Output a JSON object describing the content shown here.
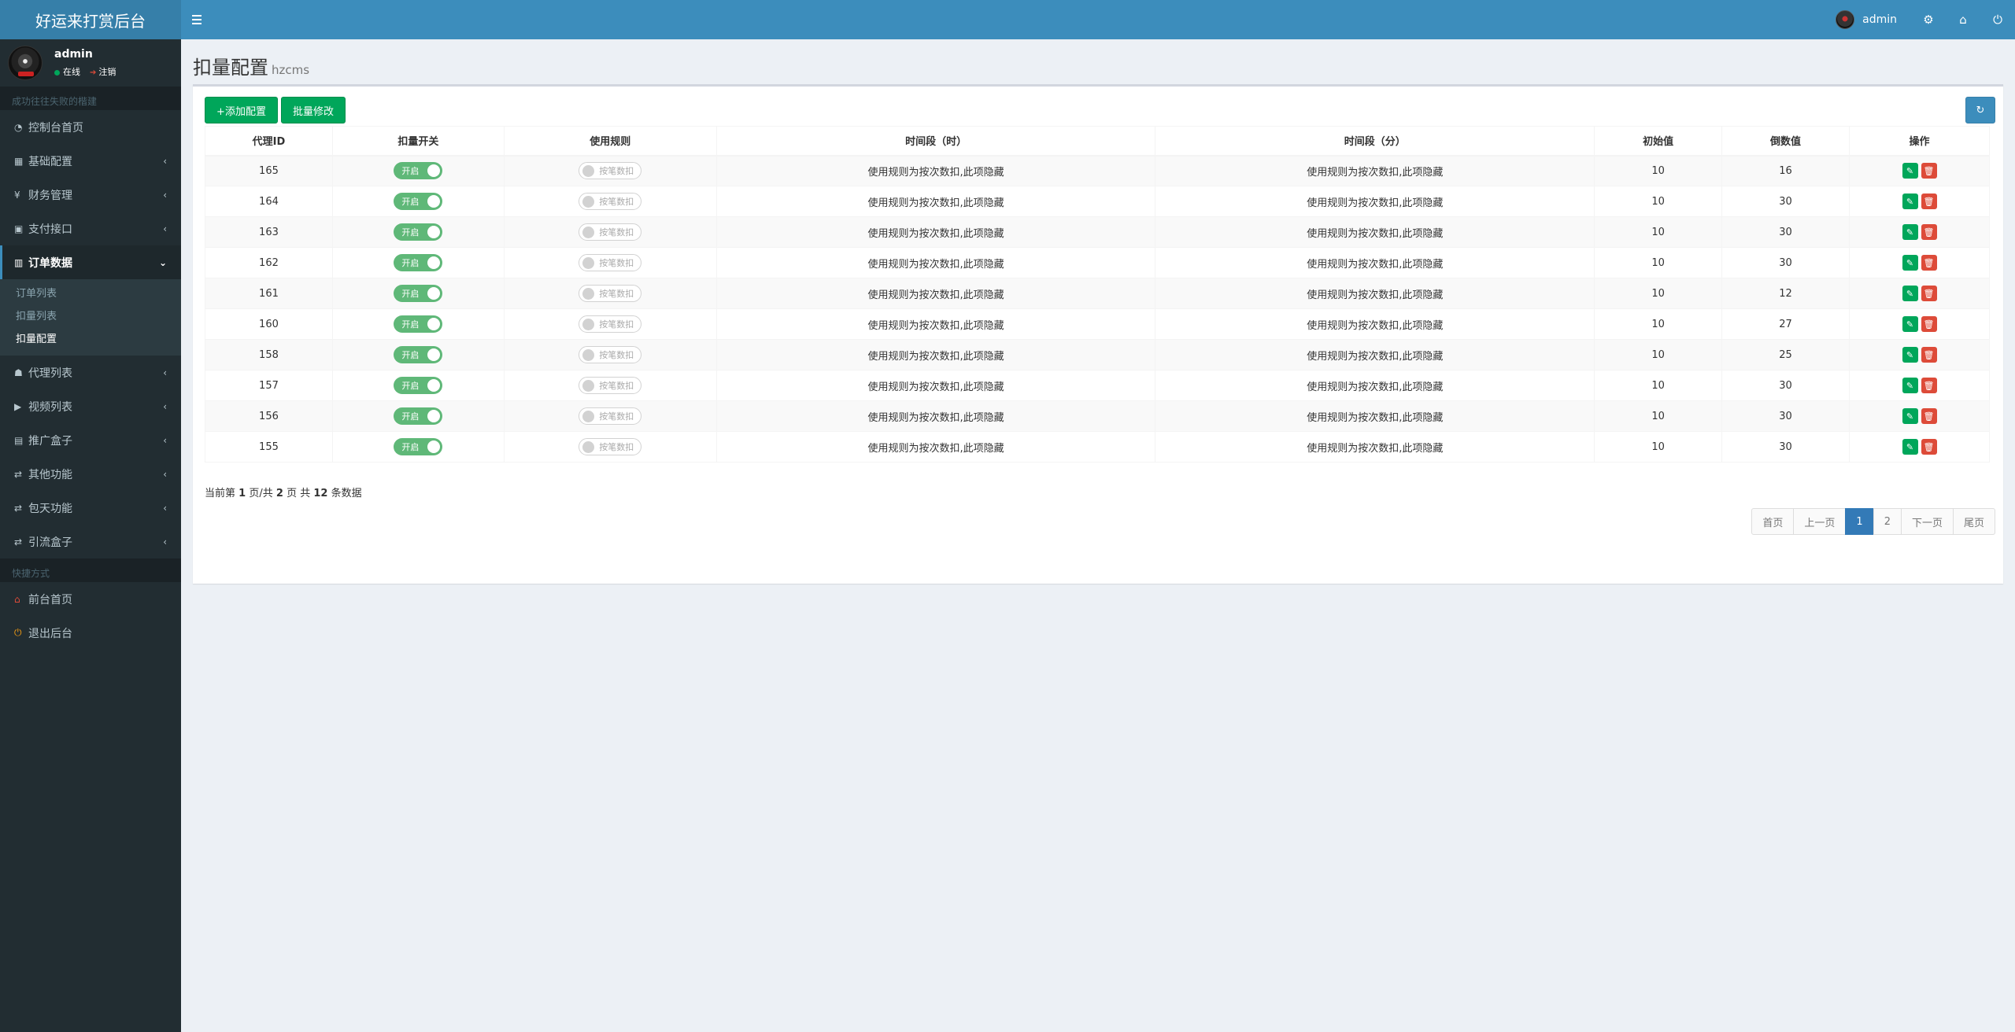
{
  "app": {
    "title": "好运来打赏后台"
  },
  "topbar": {
    "user_name": "admin",
    "icons": [
      "gears-icon",
      "home-icon",
      "power-icon"
    ]
  },
  "sidebar": {
    "user_name": "admin",
    "status_online": "在线",
    "status_logout": "注销",
    "header_text": "成功往往失败的楷建",
    "menu": [
      {
        "label": "控制台首页",
        "icon": "dashboard-icon",
        "has_children": false
      },
      {
        "label": "基础配置",
        "icon": "grid-icon",
        "has_children": true
      },
      {
        "label": "财务管理",
        "icon": "yen-icon",
        "has_children": true
      },
      {
        "label": "支付接口",
        "icon": "payment-icon",
        "has_children": true
      },
      {
        "label": "订单数据",
        "icon": "bar-chart-icon",
        "has_children": true,
        "expanded": true
      }
    ],
    "submenu": [
      "订单列表",
      "扣量列表",
      "扣量配置"
    ],
    "menu2": [
      {
        "label": "代理列表",
        "icon": "users-icon"
      },
      {
        "label": "视频列表",
        "icon": "video-icon"
      },
      {
        "label": "推广盒子",
        "icon": "box-icon"
      },
      {
        "label": "其他功能",
        "icon": "retweet-icon"
      },
      {
        "label": "包天功能",
        "icon": "retweet-icon"
      },
      {
        "label": "引流盒子",
        "icon": "retweet-icon"
      }
    ],
    "shortcut_header": "快捷方式",
    "shortcuts": [
      {
        "label": "前台首页",
        "icon": "home-icon",
        "color": "#dd4b39"
      },
      {
        "label": "退出后台",
        "icon": "power-icon",
        "color": "#f39c12"
      }
    ]
  },
  "page": {
    "title": "扣量配置",
    "subtitle": "hzcms"
  },
  "toolbar": {
    "add_label": "+添加配置",
    "batch_label": "批量修改"
  },
  "table": {
    "headers": [
      "代理ID",
      "扣量开关",
      "使用规则",
      "时间段（时）",
      "时间段（分）",
      "初始值",
      "倒数值",
      "操作"
    ],
    "switch_on_label": "开启",
    "rule_label": "按笔数扣",
    "rows": [
      {
        "id": "165",
        "hour": "使用规则为按次数扣,此项隐藏",
        "minute": "使用规则为按次数扣,此项隐藏",
        "init": "10",
        "count": "16"
      },
      {
        "id": "164",
        "hour": "使用规则为按次数扣,此项隐藏",
        "minute": "使用规则为按次数扣,此项隐藏",
        "init": "10",
        "count": "30"
      },
      {
        "id": "163",
        "hour": "使用规则为按次数扣,此项隐藏",
        "minute": "使用规则为按次数扣,此项隐藏",
        "init": "10",
        "count": "30"
      },
      {
        "id": "162",
        "hour": "使用规则为按次数扣,此项隐藏",
        "minute": "使用规则为按次数扣,此项隐藏",
        "init": "10",
        "count": "30"
      },
      {
        "id": "161",
        "hour": "使用规则为按次数扣,此项隐藏",
        "minute": "使用规则为按次数扣,此项隐藏",
        "init": "10",
        "count": "12"
      },
      {
        "id": "160",
        "hour": "使用规则为按次数扣,此项隐藏",
        "minute": "使用规则为按次数扣,此项隐藏",
        "init": "10",
        "count": "27"
      },
      {
        "id": "158",
        "hour": "使用规则为按次数扣,此项隐藏",
        "minute": "使用规则为按次数扣,此项隐藏",
        "init": "10",
        "count": "25"
      },
      {
        "id": "157",
        "hour": "使用规则为按次数扣,此项隐藏",
        "minute": "使用规则为按次数扣,此项隐藏",
        "init": "10",
        "count": "30"
      },
      {
        "id": "156",
        "hour": "使用规则为按次数扣,此项隐藏",
        "minute": "使用规则为按次数扣,此项隐藏",
        "init": "10",
        "count": "30"
      },
      {
        "id": "155",
        "hour": "使用规则为按次数扣,此项隐藏",
        "minute": "使用规则为按次数扣,此项隐藏",
        "init": "10",
        "count": "30"
      }
    ]
  },
  "summary": {
    "prefix": "当前第",
    "page": "1",
    "mid1": "页/共",
    "total_pages": "2",
    "mid2": "页 共",
    "total": "12",
    "suffix": "条数据"
  },
  "pagination": [
    "首页",
    "上一页",
    "1",
    "2",
    "下一页",
    "尾页"
  ],
  "pagination_current": "1",
  "colors": {
    "header": "#3c8dbc",
    "logo": "#367fa9",
    "sidebar": "#222d32",
    "green": "#00a65a",
    "red": "#dd4b39"
  }
}
